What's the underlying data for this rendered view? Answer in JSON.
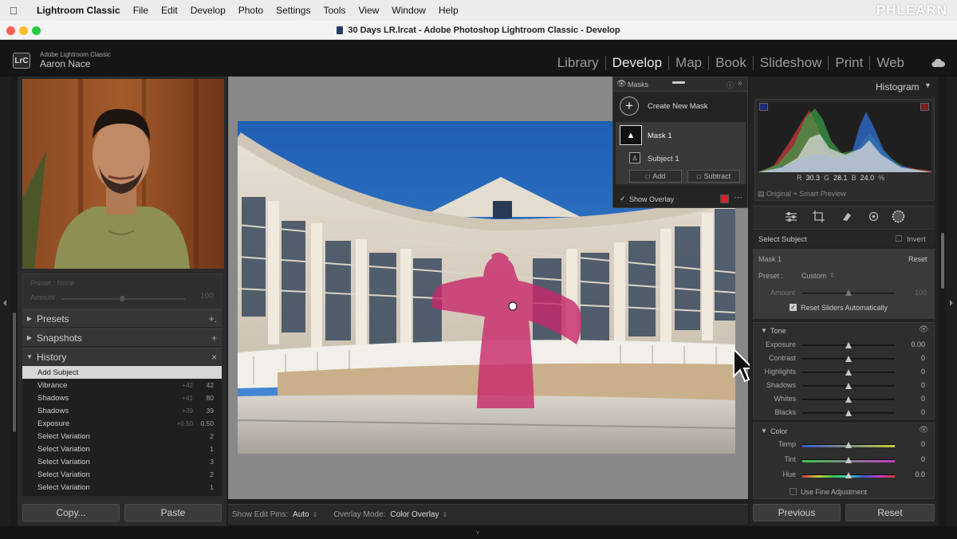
{
  "menubar": {
    "items": [
      "Lightroom Classic",
      "File",
      "Edit",
      "Develop",
      "Photo",
      "Settings",
      "Tools",
      "View",
      "Window",
      "Help"
    ],
    "watermark": "PHLEARN"
  },
  "window": {
    "title": "30 Days LR.lrcat - Adobe Photoshop Lightroom Classic - Develop"
  },
  "identity": {
    "logo": "LrC",
    "app": "Adobe Lightroom Classic",
    "user": "Aaron Nace"
  },
  "modules": [
    "Library",
    "Develop",
    "Map",
    "Book",
    "Slideshow",
    "Print",
    "Web"
  ],
  "left": {
    "preset_label": "Preset : None",
    "amount_label": "Amount",
    "amount_value": "100",
    "panels": {
      "presets": "Presets",
      "snapshots": "Snapshots",
      "history": "History"
    },
    "history": [
      {
        "name": "Add Subject",
        "d1": "",
        "d2": ""
      },
      {
        "name": "Vibrance",
        "d1": "+42",
        "d2": "42"
      },
      {
        "name": "Shadows",
        "d1": "+41",
        "d2": "80"
      },
      {
        "name": "Shadows",
        "d1": "+39",
        "d2": "39"
      },
      {
        "name": "Exposure",
        "d1": "+0.50",
        "d2": "0.50"
      },
      {
        "name": "Select Variation",
        "d1": "",
        "d2": "2"
      },
      {
        "name": "Select Variation",
        "d1": "",
        "d2": "1"
      },
      {
        "name": "Select Variation",
        "d1": "",
        "d2": "3"
      },
      {
        "name": "Select Variation",
        "d1": "",
        "d2": "2"
      },
      {
        "name": "Select Variation",
        "d1": "",
        "d2": "1"
      }
    ],
    "copy_label": "Copy...",
    "paste_label": "Paste"
  },
  "toolbar": {
    "edit_pins_label": "Show Edit Pins:",
    "edit_pins_value": "Auto",
    "overlay_label": "Overlay Mode:",
    "overlay_value": "Color Overlay"
  },
  "masks": {
    "title": "Masks",
    "create": "Create New Mask",
    "mask1": "Mask 1",
    "subject1": "Subject 1",
    "add": "Add",
    "subtract": "Subtract",
    "show_overlay": "Show Overlay",
    "overlay_color": "#d2232a"
  },
  "histogram": {
    "title": "Histogram",
    "r_label": "R",
    "r": "30.3",
    "g_label": "G",
    "g": "28.1",
    "b_label": "B",
    "b": "24.0",
    "unit": "%",
    "preview": "Original + Smart Preview"
  },
  "mask_panel": {
    "select_subject": "Select Subject",
    "invert": "Invert",
    "mask_name": "Mask 1",
    "reset": "Reset",
    "preset_label": "Preset :",
    "preset_value": "Custom",
    "amount_label": "Amount",
    "amount_value": "100",
    "reset_sliders": "Reset Sliders Automatically"
  },
  "tone": {
    "title": "Tone",
    "sliders": [
      {
        "label": "Exposure",
        "value": "0.00"
      },
      {
        "label": "Contrast",
        "value": "0"
      },
      {
        "label": "Highlights",
        "value": "0"
      },
      {
        "label": "Shadows",
        "value": "0"
      },
      {
        "label": "Whites",
        "value": "0"
      },
      {
        "label": "Blacks",
        "value": "0"
      }
    ]
  },
  "color": {
    "title": "Color",
    "sliders": [
      {
        "label": "Temp",
        "value": "0"
      },
      {
        "label": "Tint",
        "value": "0"
      },
      {
        "label": "Hue",
        "value": "0.0"
      }
    ],
    "fine": "Use Fine Adjustment"
  },
  "right_buttons": {
    "previous": "Previous",
    "reset": "Reset"
  }
}
